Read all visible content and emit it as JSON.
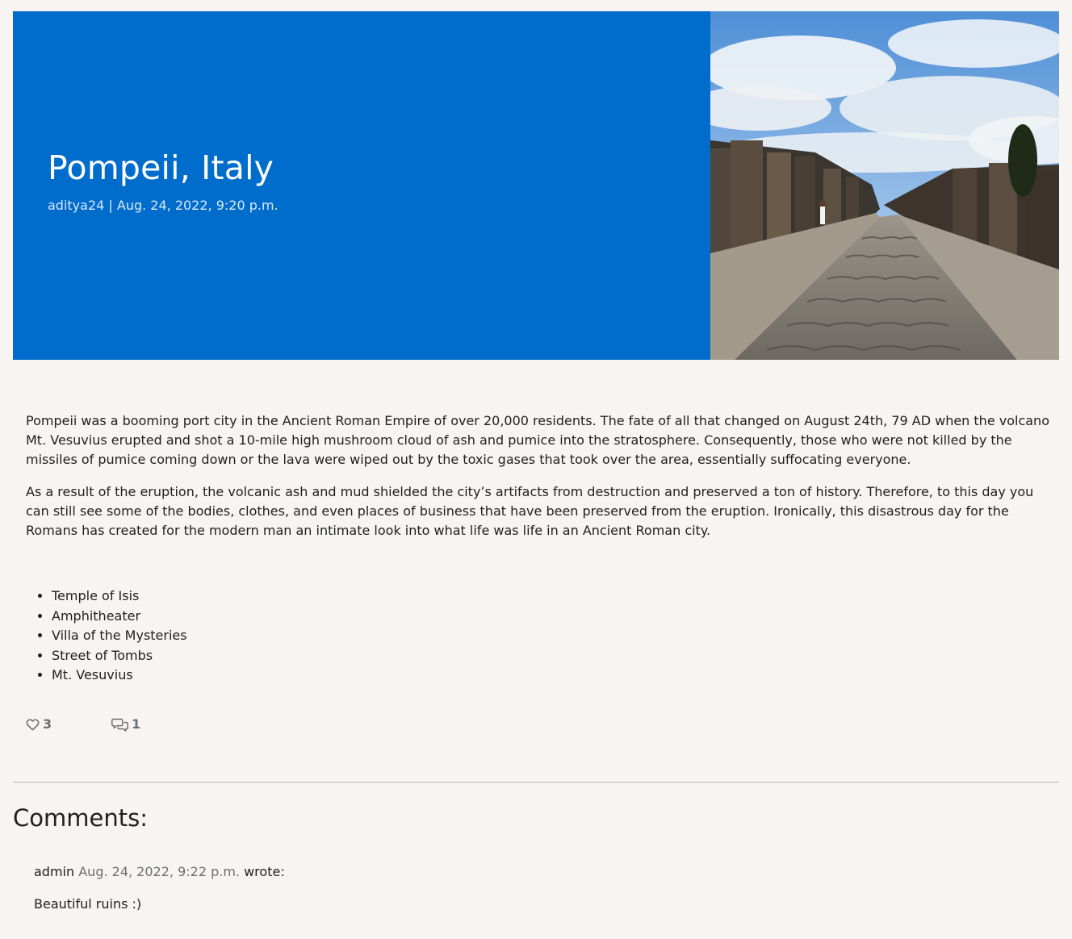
{
  "post": {
    "title": "Pompeii, Italy",
    "meta": "aditya24 | Aug. 24, 2022, 9:20 p.m.",
    "image_icon": "photo-pompeii-street",
    "hero_color": "#006dcc",
    "paragraphs": [
      "Pompeii was a booming port city in the Ancient Roman Empire of over 20,000 residents. The fate of all that changed on August 24th, 79 AD when the volcano Mt. Vesuvius erupted and shot a 10-mile high mushroom cloud of ash and pumice into the stratosphere. Consequently, those who were not killed by the missiles of pumice coming down or the lava were wiped out by the toxic gases that took over the area, essentially suffocating everyone.",
      "As a result of the eruption, the volcanic ash and mud shielded the city’s artifacts from destruction and preserved a ton of history. Therefore, to this day you can still see some of the bodies, clothes, and even places of business that have been preserved from the eruption. Ironically, this disastrous day for the Romans has created for the modern man an intimate look into what life was life in an Ancient Roman city."
    ],
    "places": [
      "Temple of Isis",
      "Amphitheater",
      "Villa of the Mysteries",
      "Street of Tombs",
      "Mt. Vesuvius"
    ],
    "likes": "3",
    "comment_count": "1"
  },
  "comments_section": {
    "heading": "Comments:",
    "items": [
      {
        "author": "admin",
        "date": "Aug. 24, 2022, 9:22 p.m.",
        "suffix": "wrote:",
        "body": "Beautiful ruins :)"
      }
    ]
  }
}
